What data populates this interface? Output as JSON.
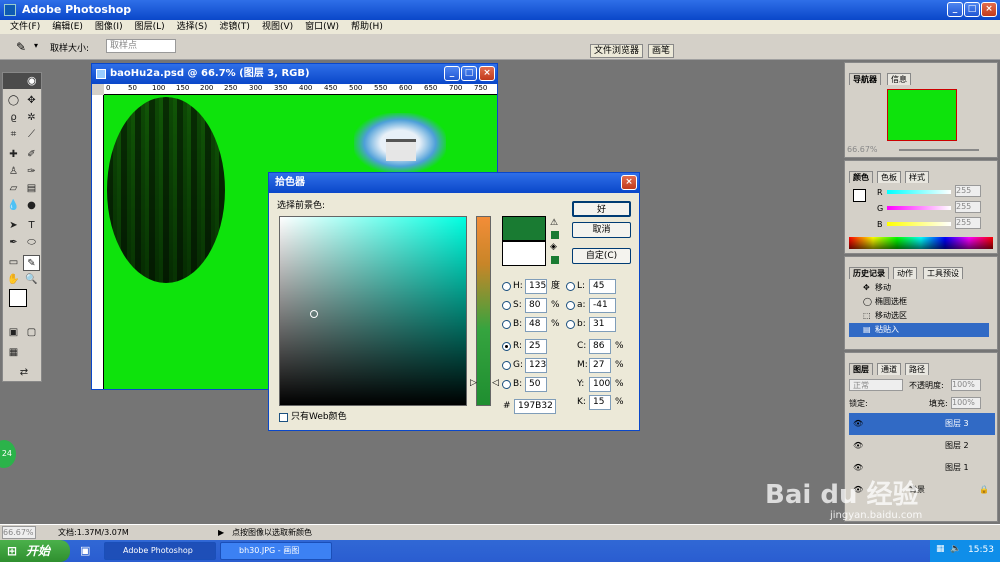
{
  "app": {
    "title": "Adobe Photoshop"
  },
  "menu": [
    "文件(F)",
    "编辑(E)",
    "图像(I)",
    "图层(L)",
    "选择(S)",
    "滤镜(T)",
    "视图(V)",
    "窗口(W)",
    "帮助(H)"
  ],
  "options": {
    "sample_size_label": "取样大小:",
    "sample_size_value": "取样点",
    "tab_browser": "文件浏览器",
    "tab_brush": "画笔"
  },
  "document": {
    "title": "baoHu2a.psd @ 66.7% (图层 3, RGB)",
    "ruler_ticks": [
      "0",
      "50",
      "100",
      "150",
      "200",
      "250",
      "300",
      "350",
      "400",
      "450",
      "500",
      "550",
      "600",
      "650",
      "700",
      "750"
    ]
  },
  "picker": {
    "title": "拾色器",
    "prompt": "选择前景色:",
    "ok": "好",
    "cancel": "取消",
    "custom": "自定(C)",
    "H": "135",
    "H_unit": "度",
    "S": "80",
    "S_unit": "%",
    "B": "48",
    "B_unit": "%",
    "R": "25",
    "G": "123",
    "Bb": "50",
    "L": "45",
    "a": "-41",
    "b": "31",
    "C": "86",
    "M": "27",
    "Y": "100",
    "K": "15",
    "pct": "%",
    "hex_label": "#",
    "hex": "197B32",
    "web_only": "只有Web颜色",
    "labels": {
      "H": "H:",
      "S": "S:",
      "B": "B:",
      "R": "R:",
      "G": "G:",
      "Bb": "B:",
      "L": "L:",
      "a": "a:",
      "b": "b:",
      "C": "C:",
      "M": "M:",
      "Y": "Y:",
      "K": "K:"
    }
  },
  "navigator": {
    "tab1": "导航器",
    "tab2": "信息",
    "zoom": "66.67%"
  },
  "color_panel": {
    "tab1": "颜色",
    "tab2": "色板",
    "tab3": "样式",
    "R": "R",
    "G": "G",
    "B": "B",
    "val": "255"
  },
  "history": {
    "tab1": "历史记录",
    "tab2": "动作",
    "tab3": "工具预设",
    "items": [
      "移动",
      "椭圆选框",
      "移动选区",
      "粘贴入"
    ]
  },
  "layers": {
    "tab1": "图层",
    "tab2": "通道",
    "tab3": "路径",
    "blend": "正常",
    "opacity_label": "不透明度:",
    "opacity": "100%",
    "lock_label": "锁定:",
    "fill_label": "填充:",
    "fill": "100%",
    "items": [
      "图层 3",
      "图层 2",
      "图层 1",
      "背景"
    ]
  },
  "status": {
    "zoom": "66.67%",
    "doc": "文档:1.37M/3.07M",
    "hint": "点按图像以选取新颜色"
  },
  "taskbar": {
    "start": "开始",
    "item1": "Adobe Photoshop",
    "item2": "bh30.JPG - 画图",
    "time": "15:53",
    "badge": "24"
  },
  "watermark": {
    "text": "Bai du 经验",
    "url": "jingyan.baidu.com"
  },
  "colors": {
    "fg": "#197B32",
    "canvas": "#0EE30C",
    "title": "#0A47C9"
  }
}
